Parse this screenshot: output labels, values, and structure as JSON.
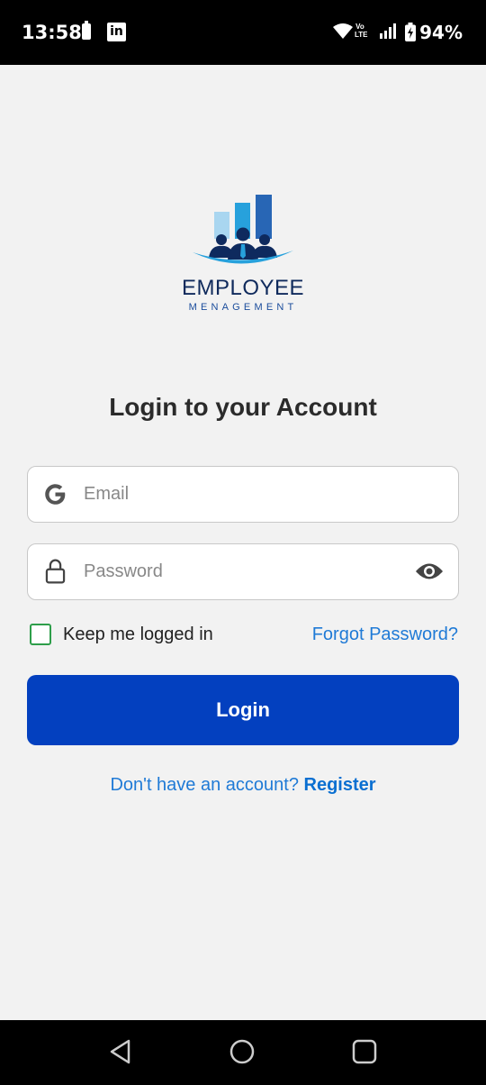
{
  "status_bar": {
    "time": "13:58",
    "volte": "Vo\nLTE",
    "battery_percent": "94%",
    "icons": [
      "battery-icon",
      "linkedin-icon",
      "wifi-icon",
      "volte-icon",
      "signal-icon",
      "battery-charging-icon"
    ]
  },
  "logo": {
    "title": "EMPLOYEE",
    "subtitle": "MENAGEMENT",
    "linkedin_glyph": "in"
  },
  "page_title": "Login to your Account",
  "email_field": {
    "placeholder": "Email",
    "value": "",
    "icon": "google-icon"
  },
  "password_field": {
    "placeholder": "Password",
    "value": "",
    "icon": "lock-icon",
    "toggle_icon": "eye-icon"
  },
  "remember_me": {
    "label": "Keep me logged in",
    "checked": false
  },
  "forgot_password": "Forgot Password?",
  "login_button": "Login",
  "register": {
    "prompt": "Don't have an account? ",
    "link": "Register"
  },
  "nav_bar": {
    "icons": [
      "back-icon",
      "home-icon",
      "recents-icon"
    ]
  },
  "colors": {
    "primary_button": "#0340bf",
    "link": "#1f7ad6",
    "checkbox_border": "#2e9e4a",
    "background": "#f2f2f2",
    "logo_dark": "#0f2a5c"
  }
}
